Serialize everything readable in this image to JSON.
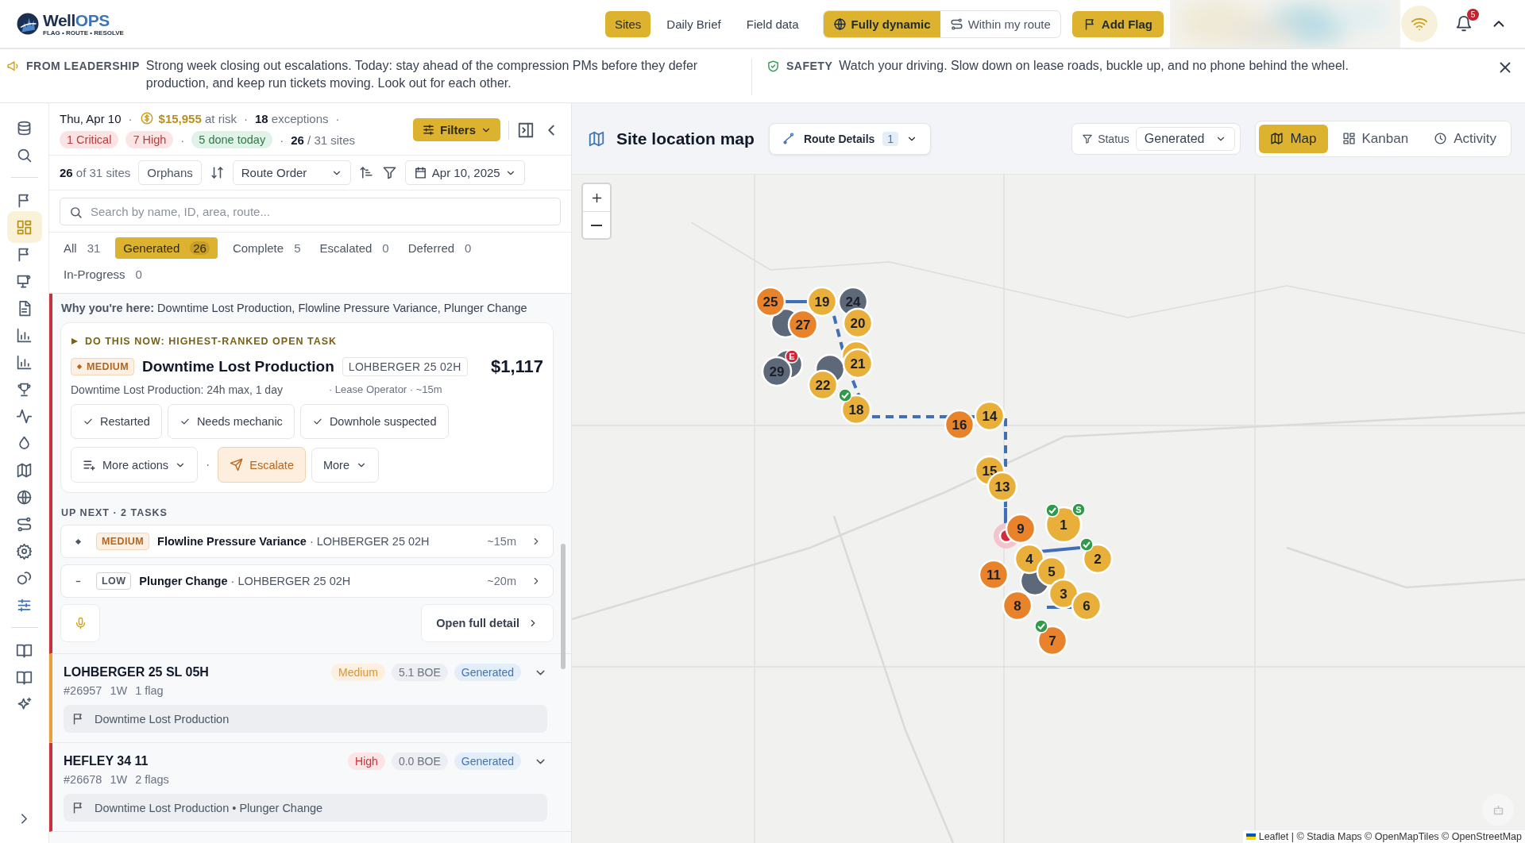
{
  "brand": {
    "name": "Well",
    "accent": "OPS",
    "tagline": "FLAG • ROUTE • RESOLVE"
  },
  "nav": [
    {
      "label": "Sites",
      "selected": true
    },
    {
      "label": "Daily Brief",
      "selected": false
    },
    {
      "label": "Field data",
      "selected": false
    }
  ],
  "modes": [
    {
      "label": "Fully dynamic",
      "selected": true
    },
    {
      "label": "Within my route",
      "selected": false
    }
  ],
  "add_flag": "Add Flag",
  "notifications": "5",
  "banners": [
    {
      "label": "FROM LEADERSHIP",
      "text": "Strong week closing out escalations. Today: stay ahead of the compression PMs before they defer production, and keep run tickets moving. Look out for each other."
    },
    {
      "label": "SAFETY",
      "text": "Watch your driving. Slow down on lease roads, buckle up, and no phone behind the wheel."
    }
  ],
  "sidebar": {
    "items": [
      {
        "selected": false
      },
      {
        "selected": false
      },
      {
        "selected": false
      },
      {
        "selected": true
      },
      {
        "selected": false
      },
      {
        "selected": false
      },
      {
        "selected": false
      },
      {
        "selected": false
      },
      {
        "selected": false
      },
      {
        "selected": false
      },
      {
        "selected": false
      },
      {
        "selected": false
      },
      {
        "selected": false
      },
      {
        "selected": false
      },
      {
        "selected": false
      },
      {
        "selected": false
      },
      {
        "selected": false
      },
      {
        "selected": false
      },
      {
        "selected": false
      },
      {
        "selected": false
      },
      {
        "selected": false
      }
    ]
  },
  "summary": {
    "row1": [
      {
        "kind": "date",
        "text": "Thu, Apr 10"
      },
      {
        "kind": "sep",
        "text": "·"
      },
      {
        "kind": "risk",
        "text": "**$15,955** at risk"
      },
      {
        "kind": "sep",
        "text": "·"
      },
      {
        "kind": "count",
        "text": "**18** exceptions"
      },
      {
        "kind": "sep",
        "text": "·"
      }
    ],
    "row2": [
      {
        "kind": "critical",
        "text": "1 Critical"
      },
      {
        "kind": "high",
        "text": "7 High"
      },
      {
        "kind": "sep",
        "text": "·"
      },
      {
        "kind": "done",
        "text": "5 done today"
      },
      {
        "kind": "sep",
        "text": "·"
      },
      {
        "kind": "count",
        "text": "**26** / 31 sites"
      }
    ],
    "filters": "Filters"
  },
  "toolbar": {
    "count": "**26** of 31 sites",
    "orphans": "Orphans",
    "order": "Route Order",
    "date": "Apr 10, 2025"
  },
  "search": {
    "placeholder": "Search by name, ID, area, route..."
  },
  "status_tabs": [
    {
      "label": "All",
      "count": "31",
      "selected": false
    },
    {
      "label": "Generated",
      "count": "26",
      "selected": true
    },
    {
      "label": "Complete",
      "count": "5",
      "selected": false
    },
    {
      "label": "Escalated",
      "count": "0",
      "selected": false
    },
    {
      "label": "Deferred",
      "count": "0",
      "selected": false
    },
    {
      "label": "In-Progress",
      "count": "0",
      "selected": false
    }
  ],
  "current": {
    "color": "#c8313a",
    "why": "**Why you're here:** Downtime Lost Production, Flowline Pressure Variance, Plunger Change",
    "do_now": "DO THIS NOW: HIGHEST-RANKED OPEN TASK",
    "priority": "MEDIUM",
    "title": "Downtime Lost Production",
    "site": "LOHBERGER 25 02H",
    "amount": "$1,117",
    "detail": "Downtime Lost Production: 24h max, 1 day",
    "meta": "· Lease Operator · ~15m",
    "quick": [
      "Restarted",
      "Needs mechanic",
      "Downhole suspected"
    ],
    "more_actions": "More actions",
    "separator": "·",
    "escalate": "Escalate",
    "more": "More",
    "up_next": "UP NEXT · 2 TASKS",
    "tasks": [
      {
        "kind": "medium",
        "priority": "MEDIUM",
        "title": "Flowline Pressure Variance",
        "site": "· LOHBERGER 25 02H",
        "time": "~15m"
      },
      {
        "kind": "low",
        "priority": "LOW",
        "title": "Plunger Change",
        "site": "· LOHBERGER 25 02H",
        "time": "~20m"
      }
    ],
    "open_detail": "Open full detail"
  },
  "sites": [
    {
      "name": "LOHBERGER 25 SL 05H",
      "color": "#e8a13a",
      "meta": [
        "#26957",
        "1W",
        "1 flag"
      ],
      "priority": {
        "label": "Medium",
        "kind": "medium"
      },
      "boe": "5.1 BOE",
      "status": "Generated",
      "flags": "Downtime Lost Production"
    },
    {
      "name": "HEFLEY 34 11",
      "color": "#c8313a",
      "meta": [
        "#26678",
        "1W",
        "2 flags"
      ],
      "priority": {
        "label": "High",
        "kind": "high"
      },
      "boe": "0.0 BOE",
      "status": "Generated",
      "flags": "Downtime Lost Production • Plunger Change"
    }
  ],
  "map": {
    "title": "Site location map",
    "route": {
      "label": "Route Details",
      "count": "1"
    },
    "status": {
      "label": "Status",
      "value": "Generated"
    },
    "views": [
      {
        "label": "Map",
        "selected": true
      },
      {
        "label": "Kanban",
        "selected": false
      },
      {
        "label": "Activity",
        "selected": false
      }
    ],
    "markers": [
      {
        "label": "25",
        "color": "#e8832c",
        "done": false
      },
      {
        "label": "19",
        "color": "#e8b03a",
        "done": false
      },
      {
        "label": "24",
        "color": "#5d6878",
        "done": false
      },
      {
        "label": "20",
        "color": "#e8b03a",
        "done": false
      },
      {
        "label": "27",
        "color": "#e8832c",
        "done": false
      },
      {
        "label": "29",
        "color": "#5d6878",
        "done": false,
        "tag": {
          "text": "E",
          "color": "#d0263a"
        }
      },
      {
        "label": "21",
        "color": "#e8b03a",
        "done": false
      },
      {
        "label": "22",
        "color": "#e8b03a",
        "done": false
      },
      {
        "label": "18",
        "color": "#e8b03a",
        "done": true
      },
      {
        "label": "16",
        "color": "#e8832c",
        "done": false
      },
      {
        "label": "14",
        "color": "#e8b03a",
        "done": false
      },
      {
        "label": "15",
        "color": "#e8b03a",
        "done": false
      },
      {
        "label": "13",
        "color": "#e8b03a",
        "done": false
      },
      {
        "label": "9",
        "color": "#e8832c",
        "done": false
      },
      {
        "label": "1",
        "color": "#e8b03a",
        "done": true,
        "tag": {
          "text": "S",
          "color": "#2e9a4a"
        }
      },
      {
        "label": "2",
        "color": "#e8b03a",
        "done": true
      },
      {
        "label": "11",
        "color": "#e8832c",
        "done": false
      },
      {
        "label": "4",
        "color": "#e8b03a",
        "done": false
      },
      {
        "label": "5",
        "color": "#e8b03a",
        "done": false
      },
      {
        "label": "8",
        "color": "#e8832c",
        "done": false
      },
      {
        "label": "3",
        "color": "#e8b03a",
        "done": false
      },
      {
        "label": "6",
        "color": "#e8b03a",
        "done": false
      },
      {
        "label": "7",
        "color": "#e8832c",
        "done": true
      }
    ],
    "attribution": "Leaflet | © Stadia Maps © OpenMapTiles © OpenStreetMap"
  }
}
